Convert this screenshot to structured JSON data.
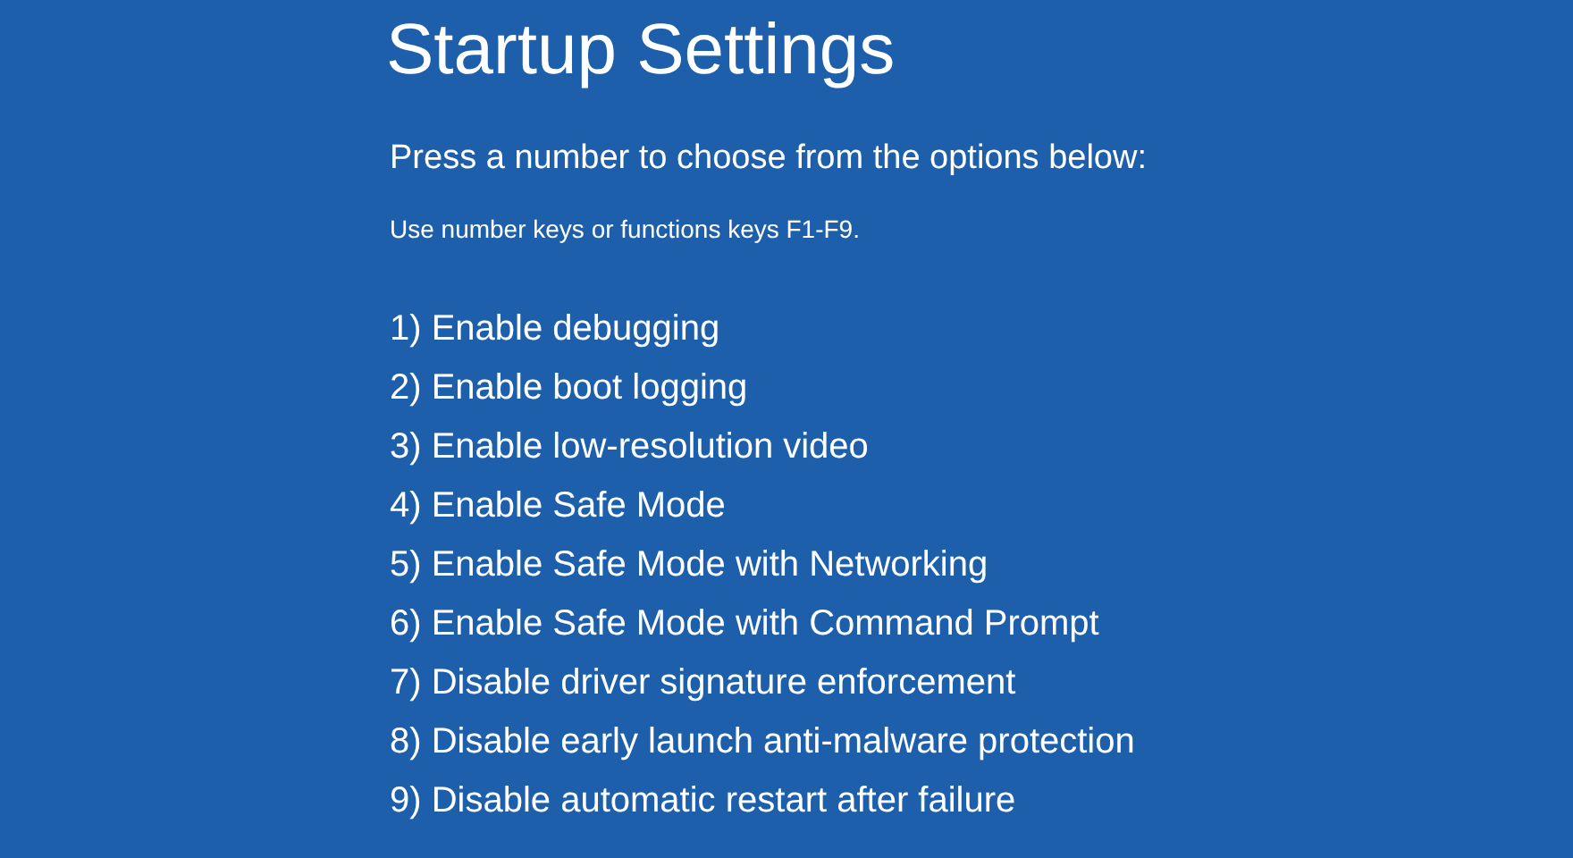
{
  "title": "Startup Settings",
  "instruction": "Press a number to choose from the options below:",
  "hint": "Use number keys or functions keys F1-F9.",
  "options": [
    "1) Enable debugging",
    "2) Enable boot logging",
    "3) Enable low-resolution video",
    "4) Enable Safe Mode",
    "5) Enable Safe Mode with Networking",
    "6) Enable Safe Mode with Command Prompt",
    "7) Disable driver signature enforcement",
    "8) Disable early launch anti-malware protection",
    "9) Disable automatic restart after failure"
  ]
}
